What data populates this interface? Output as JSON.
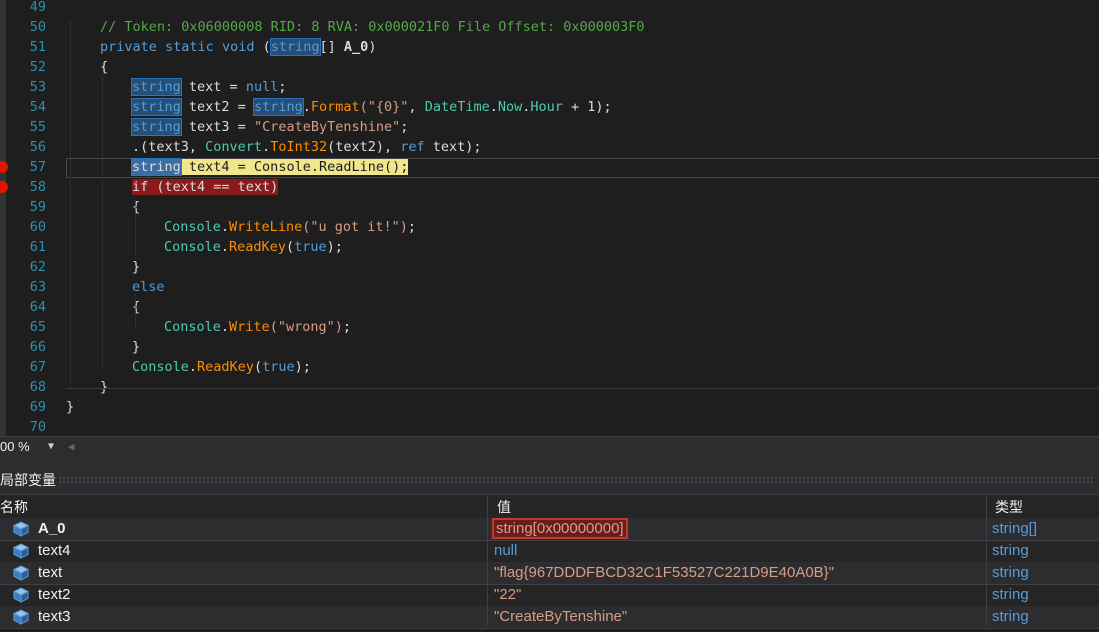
{
  "code_lines": [
    {
      "num": "49",
      "parts": []
    },
    {
      "num": "50",
      "parts": [
        {
          "t": "// Token: 0x06000008 RID: 8 RVA: 0x000021F0 File Offset: 0x000003F0",
          "c": "cm"
        }
      ]
    },
    {
      "num": "51",
      "parts": [
        {
          "t": "private",
          "c": "kw"
        },
        {
          "t": " "
        },
        {
          "t": "static",
          "c": "kw"
        },
        {
          "t": " "
        },
        {
          "t": "void",
          "c": "kw"
        },
        {
          "t": " ("
        },
        {
          "t": "string",
          "c": "kw hl"
        },
        {
          "t": "[] "
        },
        {
          "t": "A_0",
          "c": "bold"
        },
        {
          "t": ")"
        }
      ]
    },
    {
      "num": "52",
      "parts": [
        {
          "t": "{"
        }
      ]
    },
    {
      "num": "53",
      "parts": [
        {
          "t": "string",
          "c": "kw hl"
        },
        {
          "t": " text = "
        },
        {
          "t": "null",
          "c": "kw"
        },
        {
          "t": ";"
        }
      ]
    },
    {
      "num": "54",
      "parts": [
        {
          "t": "string",
          "c": "kw hl"
        },
        {
          "t": " text2 = "
        },
        {
          "t": "string",
          "c": "kw hl"
        },
        {
          "t": "."
        },
        {
          "t": "Format",
          "c": "me"
        },
        {
          "t": "(\"{0}\"",
          "c": "st"
        },
        {
          "t": ", "
        },
        {
          "t": "DateTime",
          "c": "ty"
        },
        {
          "t": "."
        },
        {
          "t": "Now",
          "c": "ty"
        },
        {
          "t": "."
        },
        {
          "t": "Hour",
          "c": "ty"
        },
        {
          "t": " + 1);"
        }
      ]
    },
    {
      "num": "55",
      "parts": [
        {
          "t": "string",
          "c": "kw hl"
        },
        {
          "t": " text3 = "
        },
        {
          "t": "\"CreateByTenshine\"",
          "c": "st"
        },
        {
          "t": ";"
        }
      ]
    },
    {
      "num": "56",
      "parts": [
        {
          "t": ".(text3, "
        },
        {
          "t": "Convert",
          "c": "ty"
        },
        {
          "t": "."
        },
        {
          "t": "ToInt32",
          "c": "me"
        },
        {
          "t": "(text2), "
        },
        {
          "t": "ref",
          "c": "kw"
        },
        {
          "t": " text);"
        }
      ]
    },
    {
      "num": "57",
      "parts": [
        {
          "t": "string",
          "c": "kw hl"
        },
        {
          "t": " text4 = Console.ReadLine();"
        }
      ]
    },
    {
      "num": "58",
      "parts": [
        {
          "t": "if (text4 == text)"
        }
      ]
    },
    {
      "num": "59",
      "parts": [
        {
          "t": "{"
        }
      ]
    },
    {
      "num": "60",
      "parts": [
        {
          "t": "Console",
          "c": "ty"
        },
        {
          "t": "."
        },
        {
          "t": "WriteLine",
          "c": "me"
        },
        {
          "t": "(\"u got it!\")",
          "c": "st"
        },
        {
          "t": ";"
        }
      ]
    },
    {
      "num": "61",
      "parts": [
        {
          "t": "Console",
          "c": "ty"
        },
        {
          "t": "."
        },
        {
          "t": "ReadKey",
          "c": "me"
        },
        {
          "t": "("
        },
        {
          "t": "true",
          "c": "kw"
        },
        {
          "t": ");"
        }
      ]
    },
    {
      "num": "62",
      "parts": [
        {
          "t": "}"
        }
      ]
    },
    {
      "num": "63",
      "parts": [
        {
          "t": "else",
          "c": "kw"
        }
      ]
    },
    {
      "num": "64",
      "parts": [
        {
          "t": "{"
        }
      ]
    },
    {
      "num": "65",
      "parts": [
        {
          "t": "Console",
          "c": "ty"
        },
        {
          "t": "."
        },
        {
          "t": "Write",
          "c": "me"
        },
        {
          "t": "(\"wrong\")",
          "c": "st"
        },
        {
          "t": ";"
        }
      ]
    },
    {
      "num": "66",
      "parts": [
        {
          "t": "}"
        }
      ]
    },
    {
      "num": "67",
      "parts": [
        {
          "t": "Console",
          "c": "ty"
        },
        {
          "t": "."
        },
        {
          "t": "ReadKey",
          "c": "me"
        },
        {
          "t": "("
        },
        {
          "t": "true",
          "c": "kw"
        },
        {
          "t": ");"
        }
      ]
    },
    {
      "num": "68",
      "parts": [
        {
          "t": "}"
        }
      ]
    },
    {
      "num": "69",
      "parts": [
        {
          "t": "}"
        }
      ]
    },
    {
      "num": "70",
      "parts": []
    }
  ],
  "current_line": "57",
  "breakpoint_lines": [
    "57",
    "58"
  ],
  "zoom": "00 %",
  "locals_panel": {
    "title": "局部变量",
    "columns": {
      "name": "名称",
      "value": "值",
      "type": "类型"
    },
    "rows": [
      {
        "name": "A_0",
        "value": "string[0x00000000]",
        "type": "string[]"
      },
      {
        "name": "text4",
        "value": "null",
        "type": "string"
      },
      {
        "name": "text",
        "value": "\"flag{967DDDFBCD32C1F53527C221D9E40A0B}\"",
        "type": "string"
      },
      {
        "name": "text2",
        "value": "\"22\"",
        "type": "string"
      },
      {
        "name": "text3",
        "value": "\"CreateByTenshine\"",
        "type": "string"
      }
    ]
  },
  "colors": {
    "keyword": "#569cd6",
    "type": "#4ec9b0",
    "method": "#ff8c00",
    "string": "#d69d85",
    "comment": "#57a64a",
    "line_number": "#2b91af",
    "breakpoint": "#e51400",
    "current_statement": "#f0e68c"
  }
}
